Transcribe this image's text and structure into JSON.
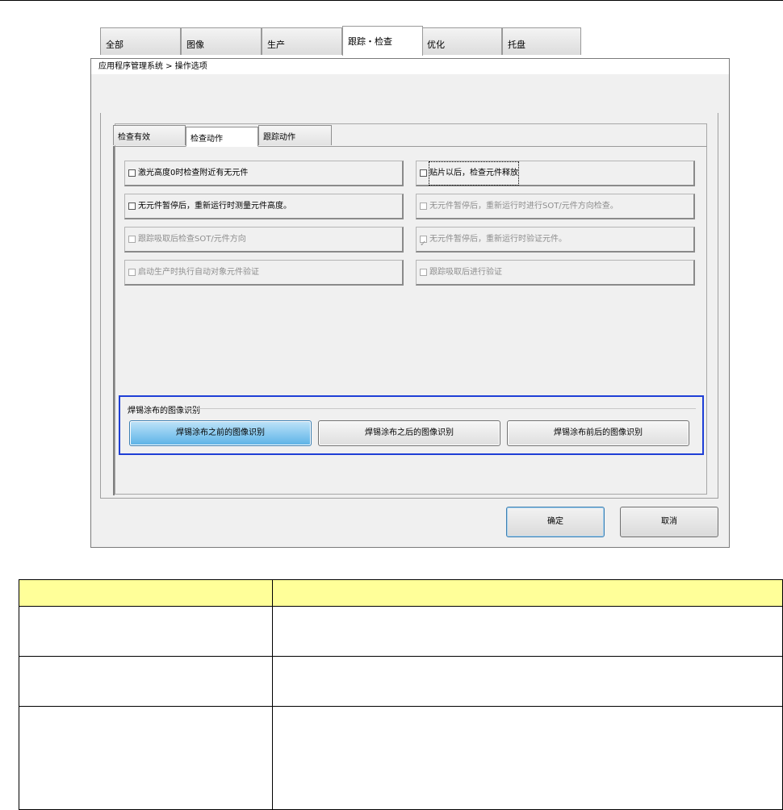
{
  "window": {
    "title": "应用程序管理系统 > 操作选项"
  },
  "tabs": [
    {
      "label": "全部",
      "active": false
    },
    {
      "label": "图像",
      "active": false
    },
    {
      "label": "生产",
      "active": false
    },
    {
      "label": "跟踪・检查",
      "active": true
    },
    {
      "label": "优化",
      "active": false
    },
    {
      "label": "托盘",
      "active": false
    }
  ],
  "sub_tabs": [
    {
      "label": "检查有效",
      "active": false
    },
    {
      "label": "检查动作",
      "active": true
    },
    {
      "label": "跟踪动作",
      "active": false
    }
  ],
  "options": [
    {
      "label": "激光高度0时检查附近有无元件",
      "checked": false,
      "enabled": true
    },
    {
      "label": "贴片以后，检查元件释放",
      "checked": false,
      "enabled": true,
      "focused": true
    },
    {
      "label": "无元件暂停后，重新运行时测量元件高度。",
      "checked": false,
      "enabled": true
    },
    {
      "label": "无元件暂停后，重新运行时进行SOT/元件方向检查。",
      "checked": false,
      "enabled": false
    },
    {
      "label": "跟踪吸取后检查SOT/元件方向",
      "checked": false,
      "enabled": false
    },
    {
      "label": "无元件暂停后，重新运行时验证元件。",
      "checked": true,
      "enabled": false
    },
    {
      "label": "启动生产时执行自动对象元件验证",
      "checked": false,
      "enabled": false
    },
    {
      "label": "跟踪吸取后进行验证",
      "checked": false,
      "enabled": false
    }
  ],
  "solder_group": {
    "label": "焊锡涂布的图像识别",
    "buttons": [
      {
        "label": "焊锡涂布之前的图像识别",
        "selected": true
      },
      {
        "label": "焊锡涂布之后的图像识别",
        "selected": false
      },
      {
        "label": "焊锡涂布前后的图像识别",
        "selected": false
      }
    ]
  },
  "footer": {
    "ok_label": "确定",
    "cancel_label": "取消"
  },
  "colors": {
    "highlight_frame": "#1f3fd6",
    "table_header": "#ffff99",
    "selected_button": "#8ccbf0"
  }
}
